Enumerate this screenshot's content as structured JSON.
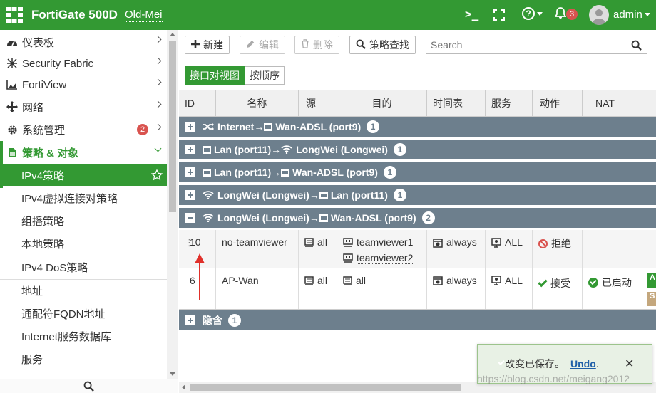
{
  "header": {
    "product": "FortiGate 500D",
    "hostname": "Old-Mei",
    "notification_count": "3",
    "user": "admin"
  },
  "sidebar": {
    "items": [
      {
        "label": "仪表板",
        "icon": "dashboard-icon"
      },
      {
        "label": "Security Fabric",
        "icon": "fabric-icon"
      },
      {
        "label": "FortiView",
        "icon": "chart-icon"
      },
      {
        "label": "网络",
        "icon": "network-icon"
      },
      {
        "label": "系统管理",
        "icon": "gear-icon",
        "badge": "2"
      },
      {
        "label": "策略 & 对象",
        "icon": "policy-icon"
      }
    ],
    "sub_items": [
      "IPv4策略",
      "IPv4虚拟连接对策略",
      "组播策略",
      "本地策略",
      "IPv4 DoS策略",
      "地址",
      "通配符FQDN地址",
      "Internet服务数据库",
      "服务"
    ]
  },
  "toolbar": {
    "new_label": "新建",
    "edit_label": "编辑",
    "delete_label": "删除",
    "lookup_label": "策略查找",
    "search_placeholder": "Search"
  },
  "view_toggle": {
    "interface_pair": "接口对视图",
    "by_sequence": "按顺序"
  },
  "columns": [
    "ID",
    "名称",
    "源",
    "目的",
    "时间表",
    "服务",
    "动作",
    "NAT"
  ],
  "groups": [
    {
      "src": "Internet",
      "dst": "Wan-ADSL (port9)",
      "count": "1",
      "expanded": false
    },
    {
      "src": "Lan (port11)",
      "dst": "LongWei (Longwei)",
      "count": "1",
      "expanded": false
    },
    {
      "src": "Lan (port11)",
      "dst": "Wan-ADSL (port9)",
      "count": "1",
      "expanded": false
    },
    {
      "src": "LongWei (Longwei)",
      "dst": "Lan (port11)",
      "count": "1",
      "expanded": false
    },
    {
      "src": "LongWei (Longwei)",
      "dst": "Wan-ADSL (port9)",
      "count": "2",
      "expanded": true
    }
  ],
  "arrow_sep": "→",
  "rows": [
    {
      "id": "10",
      "name": "no-teamviewer",
      "src": "all",
      "dst1": "teamviewer1",
      "dst2": "teamviewer2",
      "schedule": "always",
      "service": "ALL",
      "action": "拒绝",
      "nat": ""
    },
    {
      "id": "6",
      "name": "AP-Wan",
      "src": "all",
      "dst1": "all",
      "schedule": "always",
      "service": "ALL",
      "action": "接受",
      "nat": "已启动",
      "tag1": "A",
      "tag2": "S"
    }
  ],
  "implicit_group": {
    "label": "隐含",
    "count": "1"
  },
  "toast": {
    "message": "改变已保存。",
    "undo": "Undo",
    "period": "."
  },
  "watermark": "https://blog.csdn.net/meigang2012",
  "colors": {
    "brand": "#339933",
    "group_bar": "#6d7f8d",
    "deny": "#d9534f"
  }
}
